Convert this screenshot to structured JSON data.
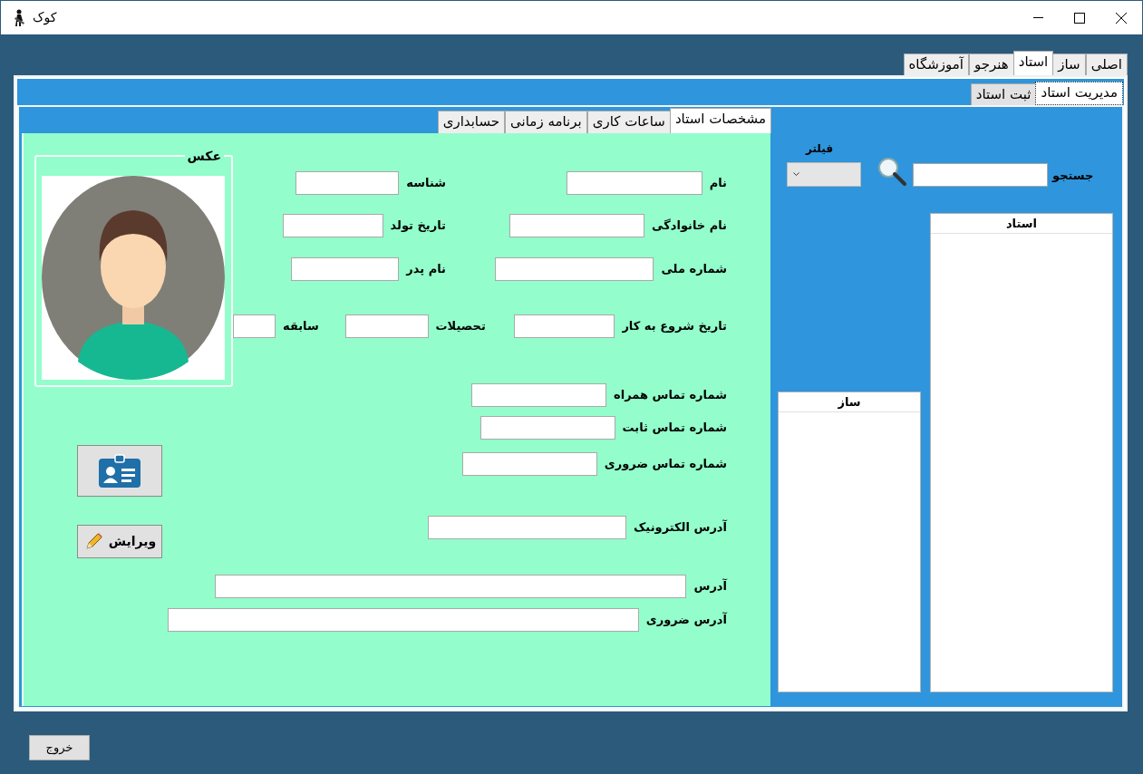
{
  "window": {
    "title": "کوک"
  },
  "main_tabs": [
    {
      "label": "اصلی",
      "selected": false
    },
    {
      "label": "ساز",
      "selected": false
    },
    {
      "label": "استاد",
      "selected": true
    },
    {
      "label": "هنرجو",
      "selected": false
    },
    {
      "label": "آموزشگاه",
      "selected": false
    }
  ],
  "sub_tabs": [
    {
      "label": "مدیریت استاد",
      "selected": true
    },
    {
      "label": "ثبت استاد",
      "selected": false
    }
  ],
  "detail_tabs": [
    {
      "label": "مشخصات استاد",
      "selected": true
    },
    {
      "label": "ساعات کاری",
      "selected": false
    },
    {
      "label": "برنامه زمانی",
      "selected": false
    },
    {
      "label": "حسابداری",
      "selected": false
    }
  ],
  "photo": {
    "title": "عکس"
  },
  "edit_button": {
    "label": "ویرایش"
  },
  "fields": [
    {
      "label": "نام"
    },
    {
      "label": "شناسه"
    },
    {
      "label": "نام خانوادگی"
    },
    {
      "label": "تاریخ تولد"
    },
    {
      "label": "شماره ملی"
    },
    {
      "label": "نام پدر"
    },
    {
      "label": "تاریخ شروع به کار"
    },
    {
      "label": "تحصیلات"
    },
    {
      "label": "سابقه"
    },
    {
      "label": "شماره تماس همراه"
    },
    {
      "label": "شماره تماس ثابت"
    },
    {
      "label": "شماره تماس ضروری"
    },
    {
      "label": "آدرس الکترونیک"
    },
    {
      "label": "آدرس"
    },
    {
      "label": "آدرس ضروری"
    }
  ],
  "search": {
    "label": "جستجو"
  },
  "filter": {
    "label": "فیلتر"
  },
  "lists": [
    {
      "header": "استاد"
    },
    {
      "header": "ساز"
    }
  ],
  "exit_button": {
    "label": "خروج"
  }
}
